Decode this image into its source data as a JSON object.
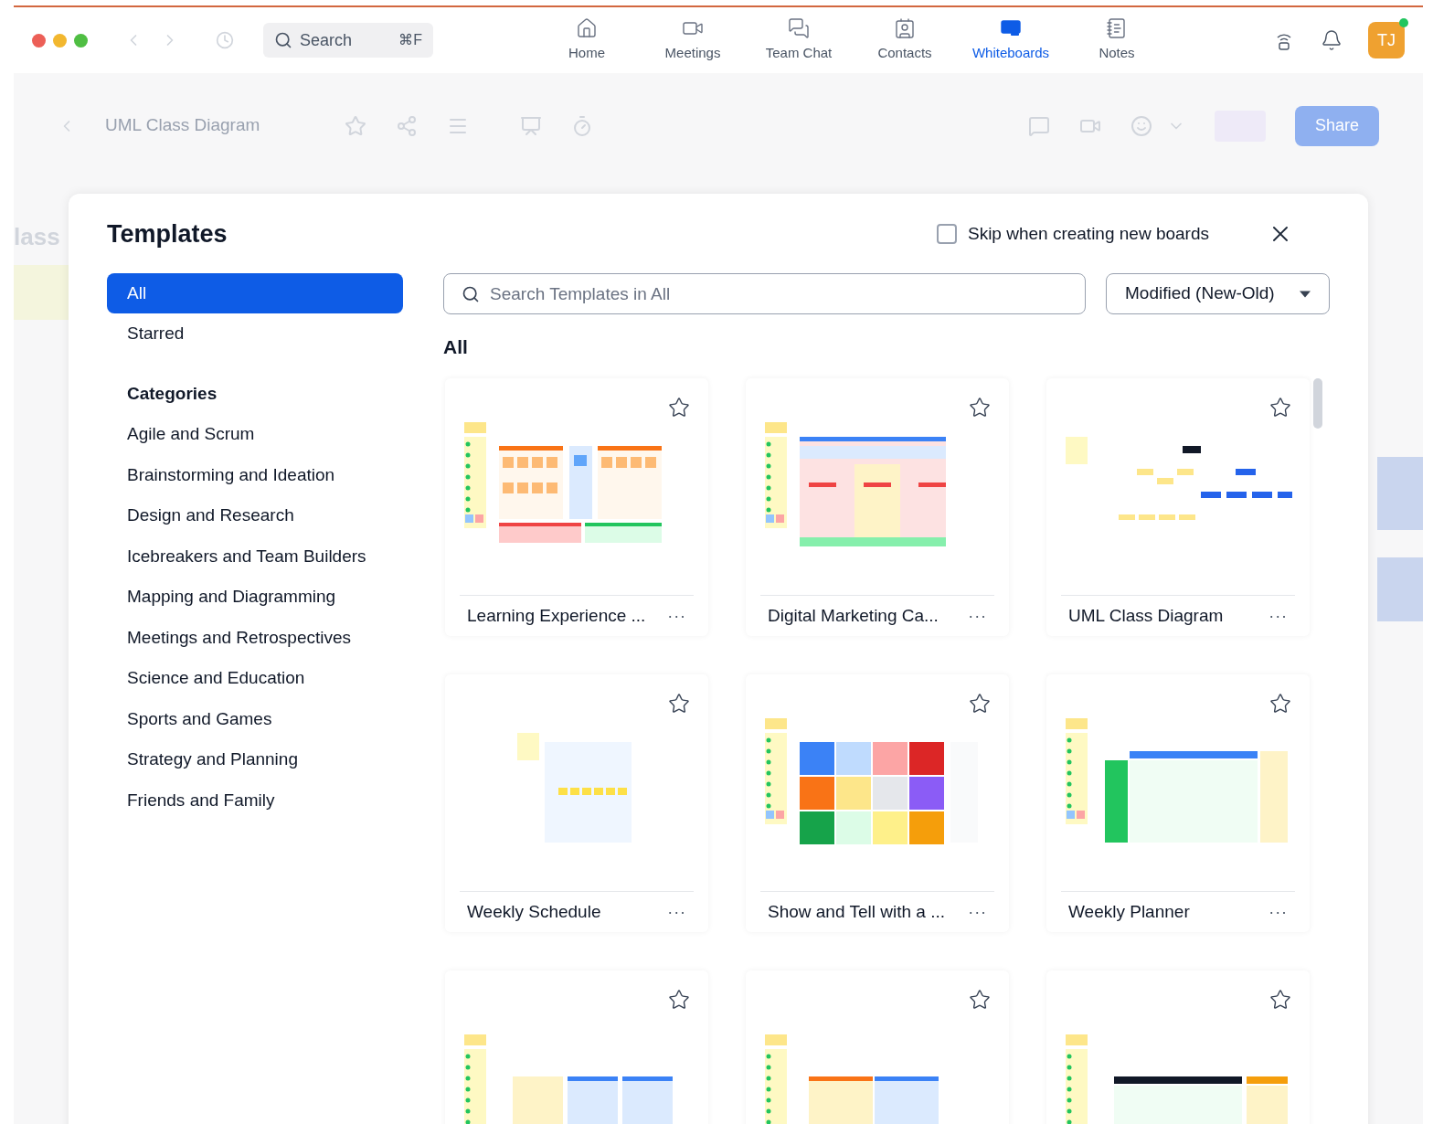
{
  "titlebar": {
    "search": {
      "placeholder": "Search",
      "shortcut": "⌘F"
    },
    "nav": [
      {
        "label": "Home",
        "kind": "home",
        "selected": false
      },
      {
        "label": "Meetings",
        "kind": "video",
        "selected": false
      },
      {
        "label": "Team Chat",
        "kind": "chat",
        "selected": false
      },
      {
        "label": "Contacts",
        "kind": "contact",
        "selected": false
      },
      {
        "label": "Whiteboards",
        "kind": "board",
        "selected": true
      },
      {
        "label": "Notes",
        "kind": "notes",
        "selected": false
      }
    ],
    "avatar": {
      "initials": "TJ",
      "online": true
    }
  },
  "board_toolbar": {
    "title": "UML Class Diagram",
    "share": "Share"
  },
  "background_canvas": {
    "title_fragment": "lass"
  },
  "templates": {
    "title": "Templates",
    "skip": {
      "label": "Skip when creating new boards",
      "checked": false
    },
    "sidebar": {
      "items": [
        {
          "label": "All",
          "selected": true
        },
        {
          "label": "Starred",
          "selected": false
        }
      ],
      "categories_heading": "Categories",
      "categories": [
        {
          "label": "Agile and Scrum",
          "selected": false
        },
        {
          "label": "Brainstorming and Ideation",
          "selected": false
        },
        {
          "label": "Design and Research",
          "selected": false
        },
        {
          "label": "Icebreakers and Team Builders",
          "selected": false
        },
        {
          "label": "Mapping and Diagramming",
          "selected": false
        },
        {
          "label": "Meetings and Retrospectives",
          "selected": false
        },
        {
          "label": "Science and Education",
          "selected": false
        },
        {
          "label": "Sports and Games",
          "selected": false
        },
        {
          "label": "Strategy and Planning",
          "selected": false
        },
        {
          "label": "Friends and Family",
          "selected": false
        }
      ]
    },
    "search": {
      "placeholder": "Search Templates in All"
    },
    "sort": {
      "value": "Modified (New-Old)"
    },
    "section_heading": "All",
    "cards": [
      {
        "title": "Learning Experience ...",
        "kind": "columns",
        "starred": false,
        "more": "···"
      },
      {
        "title": "Digital Marketing Ca...",
        "kind": "table",
        "starred": false,
        "more": "···"
      },
      {
        "title": "UML Class Diagram",
        "kind": "tree",
        "starred": false,
        "more": "···"
      },
      {
        "title": "Weekly Schedule",
        "kind": "schedule",
        "starred": false,
        "more": "···"
      },
      {
        "title": "Show and Tell with a ...",
        "kind": "mosaic",
        "starred": false,
        "more": "···"
      },
      {
        "title": "Weekly Planner",
        "kind": "planner",
        "starred": false,
        "more": "···"
      },
      {
        "kind": "lab",
        "starred": false
      },
      {
        "kind": "quadrant",
        "starred": false
      },
      {
        "kind": "matrix",
        "starred": false
      }
    ]
  }
}
